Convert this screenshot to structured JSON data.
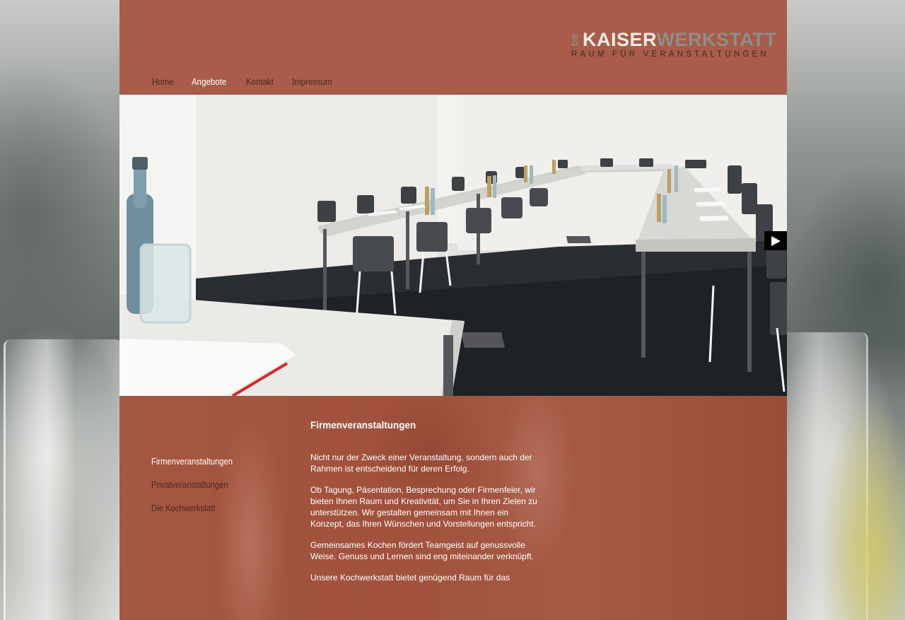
{
  "logo": {
    "die": "DIE",
    "word_primary": "KAISER",
    "word_secondary": "WERKSTATT",
    "tagline": "RAUM FÜR VERANSTALTUNGEN"
  },
  "nav": {
    "items": [
      {
        "label": "Home",
        "active": false
      },
      {
        "label": "Angebote",
        "active": true
      },
      {
        "label": "Kontakt",
        "active": false
      },
      {
        "label": "Impressum",
        "active": false
      }
    ]
  },
  "hero": {
    "next_icon": "play-right-arrow-icon",
    "next_symbol": "▶"
  },
  "subnav": {
    "items": [
      {
        "label": "Firmenveranstaltungen",
        "active": true
      },
      {
        "label": "Privatveranstaltungen",
        "active": false
      },
      {
        "label": "Die Kochwerkstatt",
        "active": false
      }
    ]
  },
  "article": {
    "title": "Firmenveranstaltungen",
    "paragraphs": [
      "Nicht nur der Zweck einer Veranstaltung, sondern auch der Rahmen ist entscheidend für deren Erfolg.",
      "Ob Tagung, Päsentation, Besprechung oder Firmenfeier, wir bieten Ihnen Raum und Kreativität, um Sie in Ihren Zielen zu unterstützen. Wir gestalten gemeinsam mit Ihnen ein Konzept, das Ihren Wünschen und Vorstellungen entspricht.",
      "Gemeinsames Kochen fördert Teamgeist auf genussvolle Weise. Genuss und Lernen sind eng miteinander verknüpft.",
      "Unsere Kochwerkstatt bietet genügend Raum für das"
    ]
  },
  "colors": {
    "header_bg": "#a85c49",
    "content_bg": "#a1513c",
    "nav_text": "#4a2a22",
    "nav_active": "#ffffff"
  }
}
